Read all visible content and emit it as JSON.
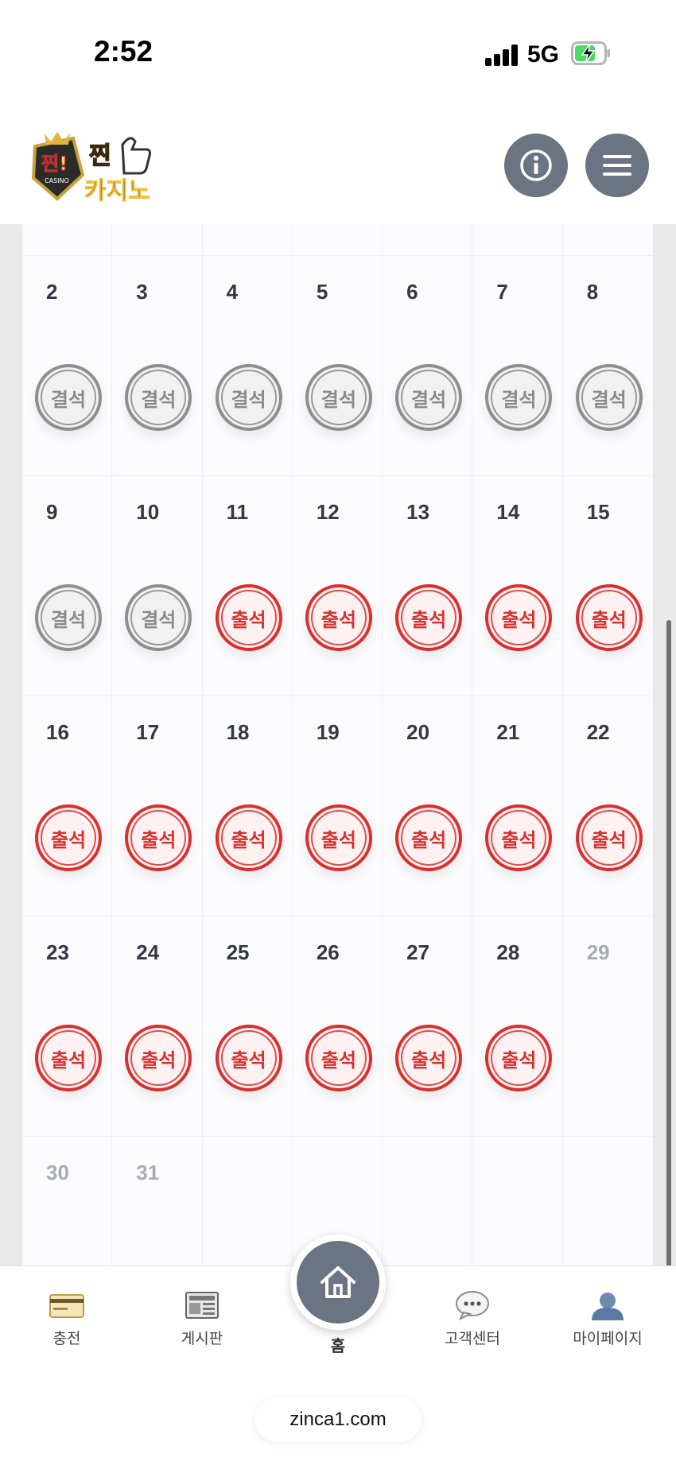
{
  "status_bar": {
    "time": "2:52",
    "network": "5G"
  },
  "header": {
    "logo_text_top": "찐!",
    "logo_text_bottom": "카지노",
    "logo_small": "CASINO"
  },
  "calendar": {
    "rows": [
      {
        "days": [
          {
            "day": "2",
            "stamp": "결석",
            "state": "absent"
          },
          {
            "day": "3",
            "stamp": "결석",
            "state": "absent"
          },
          {
            "day": "4",
            "stamp": "결석",
            "state": "absent"
          },
          {
            "day": "5",
            "stamp": "결석",
            "state": "absent"
          },
          {
            "day": "6",
            "stamp": "결석",
            "state": "absent"
          },
          {
            "day": "7",
            "stamp": "결석",
            "state": "absent"
          },
          {
            "day": "8",
            "stamp": "결석",
            "state": "absent"
          }
        ]
      },
      {
        "days": [
          {
            "day": "9",
            "stamp": "결석",
            "state": "absent"
          },
          {
            "day": "10",
            "stamp": "결석",
            "state": "absent"
          },
          {
            "day": "11",
            "stamp": "출석",
            "state": "present"
          },
          {
            "day": "12",
            "stamp": "출석",
            "state": "present"
          },
          {
            "day": "13",
            "stamp": "출석",
            "state": "present"
          },
          {
            "day": "14",
            "stamp": "출석",
            "state": "present"
          },
          {
            "day": "15",
            "stamp": "출석",
            "state": "present"
          }
        ]
      },
      {
        "days": [
          {
            "day": "16",
            "stamp": "출석",
            "state": "present"
          },
          {
            "day": "17",
            "stamp": "출석",
            "state": "present"
          },
          {
            "day": "18",
            "stamp": "출석",
            "state": "present"
          },
          {
            "day": "19",
            "stamp": "출석",
            "state": "present"
          },
          {
            "day": "20",
            "stamp": "출석",
            "state": "present"
          },
          {
            "day": "21",
            "stamp": "출석",
            "state": "present"
          },
          {
            "day": "22",
            "stamp": "출석",
            "state": "present"
          }
        ]
      },
      {
        "days": [
          {
            "day": "23",
            "stamp": "출석",
            "state": "present"
          },
          {
            "day": "24",
            "stamp": "출석",
            "state": "present"
          },
          {
            "day": "25",
            "stamp": "출석",
            "state": "present"
          },
          {
            "day": "26",
            "stamp": "출석",
            "state": "present"
          },
          {
            "day": "27",
            "stamp": "출석",
            "state": "present"
          },
          {
            "day": "28",
            "stamp": "출석",
            "state": "present"
          },
          {
            "day": "29",
            "stamp": "",
            "state": "future"
          }
        ]
      },
      {
        "days": [
          {
            "day": "30",
            "stamp": "",
            "state": "future"
          },
          {
            "day": "31",
            "stamp": "",
            "state": "future"
          },
          {
            "day": "",
            "stamp": "",
            "state": "empty"
          },
          {
            "day": "",
            "stamp": "",
            "state": "empty"
          },
          {
            "day": "",
            "stamp": "",
            "state": "empty"
          },
          {
            "day": "",
            "stamp": "",
            "state": "empty"
          },
          {
            "day": "",
            "stamp": "",
            "state": "empty"
          }
        ]
      }
    ]
  },
  "nav": {
    "charge": "충전",
    "board": "게시판",
    "home": "홈",
    "support": "고객센터",
    "mypage": "마이페이지"
  },
  "browser": {
    "url": "zinca1.com"
  },
  "colors": {
    "present": "#d9302e",
    "absent": "#8e8e8e",
    "header_button": "#6b7483"
  }
}
